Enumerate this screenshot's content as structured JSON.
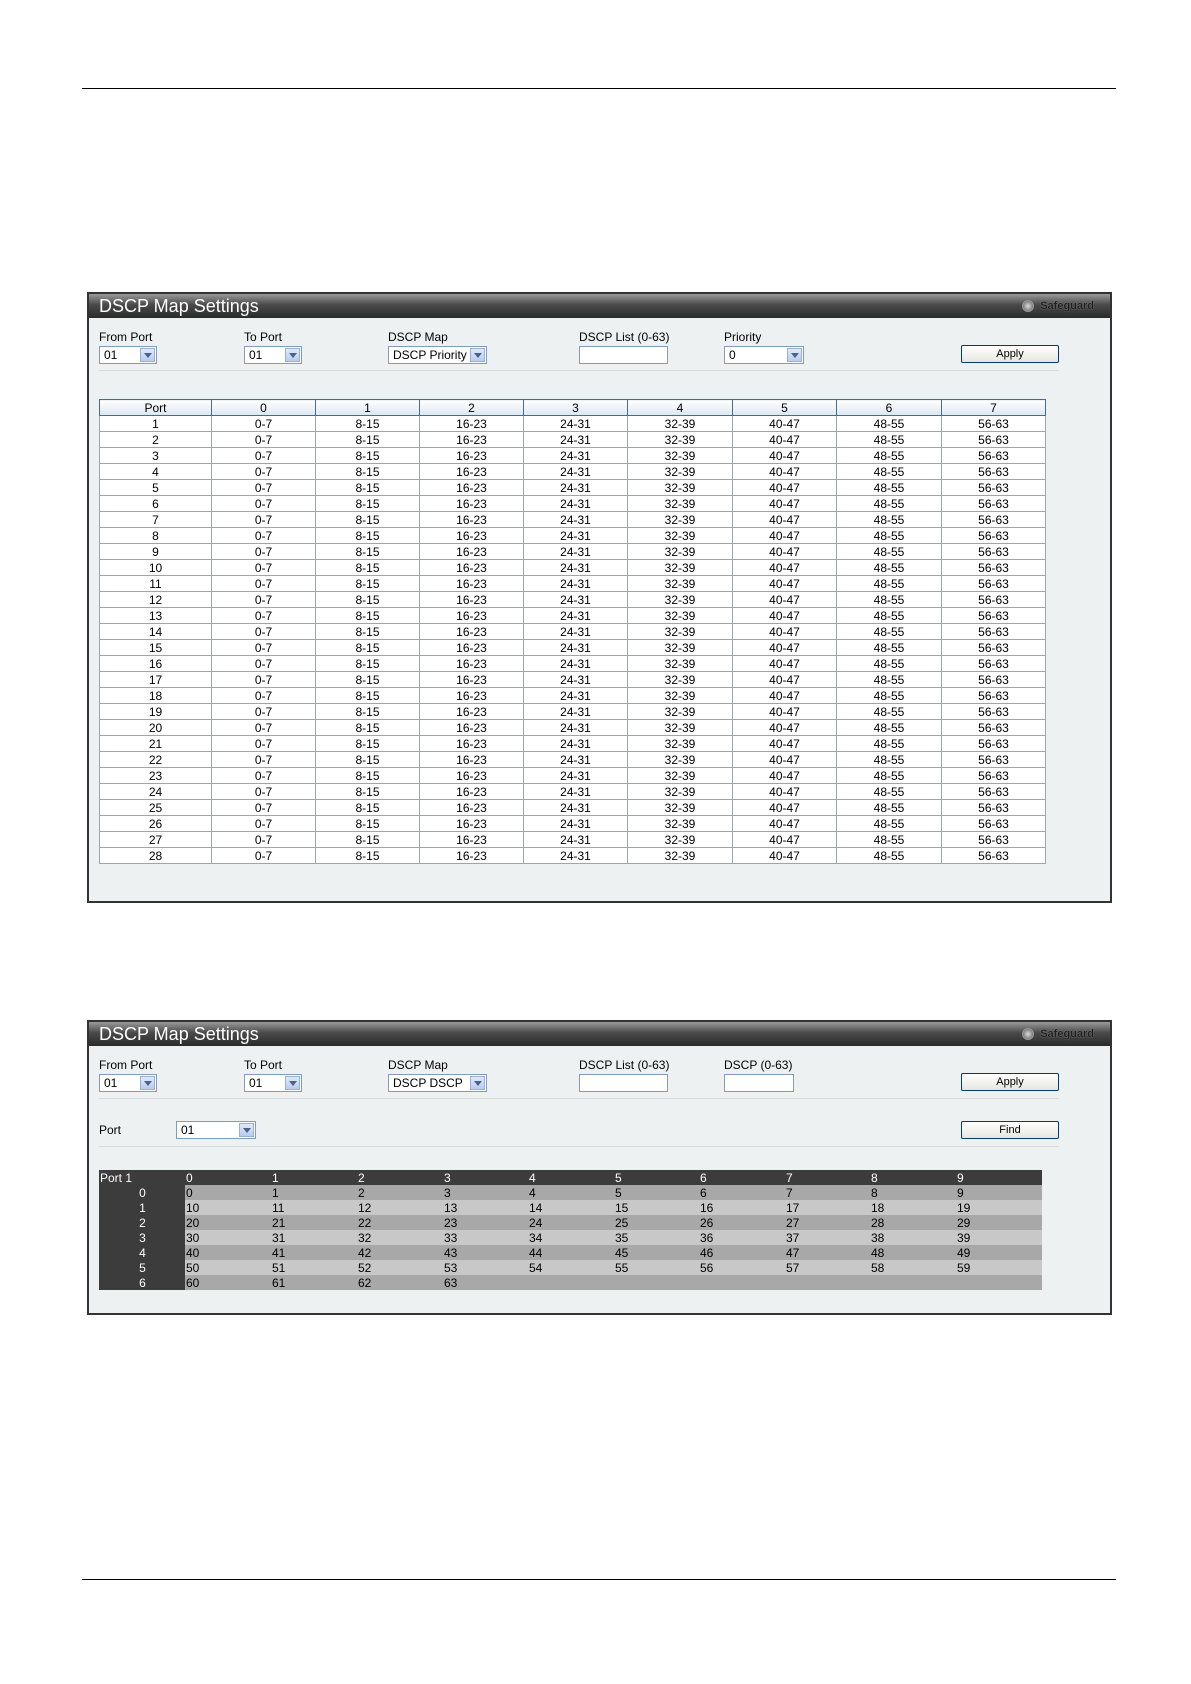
{
  "panel1": {
    "title": "DSCP Map Settings",
    "safeguard": "Safeguard",
    "from_port": {
      "label": "From Port",
      "value": "01"
    },
    "to_port": {
      "label": "To Port",
      "value": "01"
    },
    "dscp_map": {
      "label": "DSCP Map",
      "value": "DSCP Priority"
    },
    "dscp_list": {
      "label": "DSCP List (0-63)",
      "value": ""
    },
    "priority": {
      "label": "Priority",
      "value": "0"
    },
    "apply_label": "Apply",
    "table": {
      "headers": [
        "Port",
        "0",
        "1",
        "2",
        "3",
        "4",
        "5",
        "6",
        "7"
      ],
      "ranges": [
        "0-7",
        "8-15",
        "16-23",
        "24-31",
        "32-39",
        "40-47",
        "48-55",
        "56-63"
      ],
      "ports": [
        "1",
        "2",
        "3",
        "4",
        "5",
        "6",
        "7",
        "8",
        "9",
        "10",
        "11",
        "12",
        "13",
        "14",
        "15",
        "16",
        "17",
        "18",
        "19",
        "20",
        "21",
        "22",
        "23",
        "24",
        "25",
        "26",
        "27",
        "28"
      ]
    }
  },
  "panel2": {
    "title": "DSCP Map Settings",
    "safeguard": "Safeguard",
    "from_port": {
      "label": "From Port",
      "value": "01"
    },
    "to_port": {
      "label": "To Port",
      "value": "01"
    },
    "dscp_map": {
      "label": "DSCP Map",
      "value": "DSCP DSCP"
    },
    "dscp_list": {
      "label": "DSCP List (0-63)",
      "value": ""
    },
    "dscp": {
      "label": "DSCP (0-63)",
      "value": ""
    },
    "apply_label": "Apply",
    "port": {
      "label": "Port",
      "value": "01"
    },
    "find_label": "Find",
    "table": {
      "corner": "Port 1",
      "col_headers": [
        "0",
        "1",
        "2",
        "3",
        "4",
        "5",
        "6",
        "7",
        "8",
        "9"
      ],
      "rows": [
        {
          "label": "0",
          "cells": [
            "0",
            "1",
            "2",
            "3",
            "4",
            "5",
            "6",
            "7",
            "8",
            "9"
          ]
        },
        {
          "label": "1",
          "cells": [
            "10",
            "11",
            "12",
            "13",
            "14",
            "15",
            "16",
            "17",
            "18",
            "19"
          ]
        },
        {
          "label": "2",
          "cells": [
            "20",
            "21",
            "22",
            "23",
            "24",
            "25",
            "26",
            "27",
            "28",
            "29"
          ]
        },
        {
          "label": "3",
          "cells": [
            "30",
            "31",
            "32",
            "33",
            "34",
            "35",
            "36",
            "37",
            "38",
            "39"
          ]
        },
        {
          "label": "4",
          "cells": [
            "40",
            "41",
            "42",
            "43",
            "44",
            "45",
            "46",
            "47",
            "48",
            "49"
          ]
        },
        {
          "label": "5",
          "cells": [
            "50",
            "51",
            "52",
            "53",
            "54",
            "55",
            "56",
            "57",
            "58",
            "59"
          ]
        },
        {
          "label": "6",
          "cells": [
            "60",
            "61",
            "62",
            "63",
            "",
            "",
            "",
            "",
            "",
            ""
          ]
        }
      ]
    }
  }
}
